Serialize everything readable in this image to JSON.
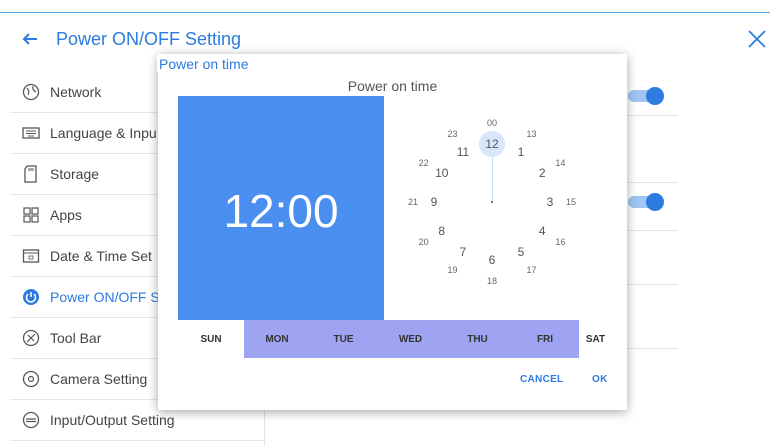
{
  "header": {
    "title": "Power ON/OFF Setting"
  },
  "sidebar": {
    "items": [
      {
        "label": "Network",
        "icon": "globe-icon"
      },
      {
        "label": "Language & Inpu",
        "icon": "keyboard-icon"
      },
      {
        "label": "Storage",
        "icon": "sd-card-icon"
      },
      {
        "label": "Apps",
        "icon": "apps-grid-icon"
      },
      {
        "label": "Date & Time Set",
        "icon": "calendar-icon"
      },
      {
        "label": "Power ON/OFF S",
        "icon": "power-icon",
        "active": true
      },
      {
        "label": "Tool Bar",
        "icon": "toolbar-icon"
      },
      {
        "label": "Camera Setting",
        "icon": "camera-icon"
      },
      {
        "label": "Input/Output Setting",
        "icon": "input-output-icon"
      }
    ]
  },
  "dialog": {
    "title": "Power on time",
    "heading": "Power on time",
    "time": "12:00",
    "clock": {
      "selected": "12",
      "outer": [
        "12",
        "1",
        "2",
        "3",
        "4",
        "5",
        "6",
        "7",
        "8",
        "9",
        "10",
        "11"
      ],
      "inner": [
        "00",
        "13",
        "14",
        "15",
        "16",
        "17",
        "18",
        "19",
        "20",
        "21",
        "22",
        "23"
      ]
    },
    "days": [
      {
        "label": "SUN",
        "selected": false
      },
      {
        "label": "MON",
        "selected": true
      },
      {
        "label": "TUE",
        "selected": true
      },
      {
        "label": "WED",
        "selected": true
      },
      {
        "label": "THU",
        "selected": true
      },
      {
        "label": "FRI",
        "selected": true
      },
      {
        "label": "SAT",
        "selected": false
      }
    ],
    "cancel_label": "CANCEL",
    "ok_label": "OK"
  },
  "colors": {
    "accent": "#2c7be0",
    "time_panel": "#4a8ff0",
    "day_selected": "#9ea4f2"
  }
}
